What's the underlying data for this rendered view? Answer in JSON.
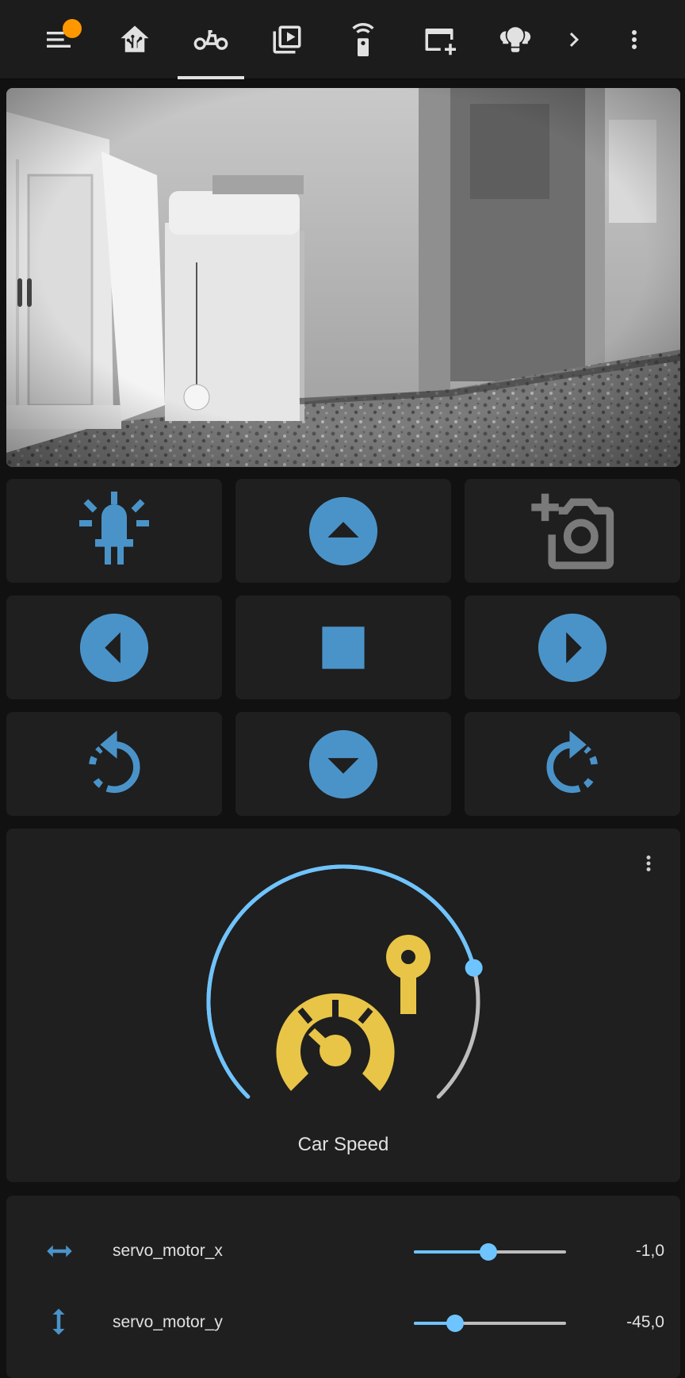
{
  "toolbar": {
    "tabs": [
      {
        "icon": "menu-icon",
        "badge": true
      },
      {
        "icon": "home-assistant-icon"
      },
      {
        "icon": "robot-car-icon",
        "active": true
      },
      {
        "icon": "media-playlist-icon"
      },
      {
        "icon": "remote-icon"
      },
      {
        "icon": "card-plus-icon"
      },
      {
        "icon": "lightbulb-group-icon"
      },
      {
        "icon": "chevron-right-icon"
      },
      {
        "icon": "dots-vertical-icon"
      }
    ]
  },
  "colors": {
    "accent": "#4a93c9",
    "slider": "#6ec4ff",
    "gauge_icon": "#e8c547",
    "card_bg": "#1f1f1f",
    "page_bg": "#111111",
    "badge": "#ff9800"
  },
  "controls": {
    "buttons": [
      {
        "icon": "led-on-icon"
      },
      {
        "icon": "arrow-up-circle-icon"
      },
      {
        "icon": "camera-plus-icon"
      },
      {
        "icon": "arrow-left-circle-icon"
      },
      {
        "icon": "stop-icon"
      },
      {
        "icon": "arrow-right-circle-icon"
      },
      {
        "icon": "rotate-left-icon"
      },
      {
        "icon": "arrow-down-circle-icon"
      },
      {
        "icon": "rotate-right-icon"
      }
    ]
  },
  "gauge": {
    "title": "Car Speed",
    "icon": "speedometer-key-icon",
    "value_fraction": 0.78
  },
  "entities": [
    {
      "icon": "arrow-left-right-icon",
      "name": "servo_motor_x",
      "value": "-1,0",
      "slider_fraction": 0.49
    },
    {
      "icon": "arrow-up-down-icon",
      "name": "servo_motor_y",
      "value": "-45,0",
      "slider_fraction": 0.27
    }
  ]
}
